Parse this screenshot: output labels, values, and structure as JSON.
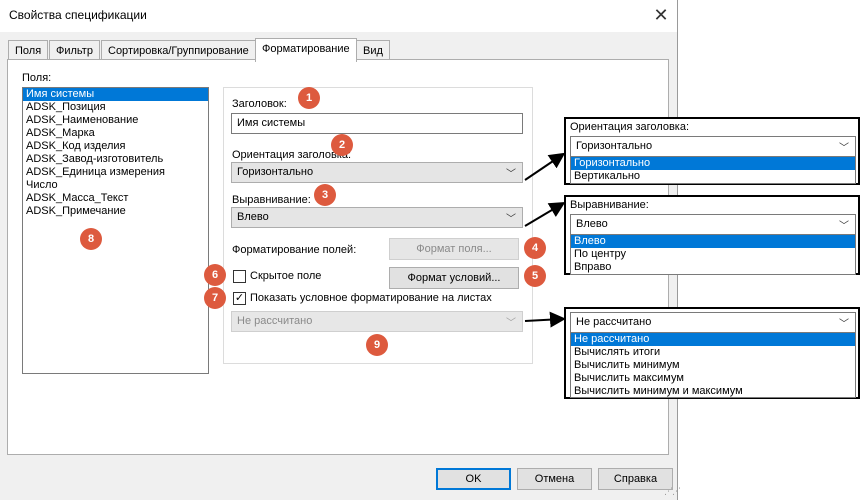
{
  "window": {
    "title": "Свойства спецификации",
    "close_glyph": "✕"
  },
  "tabs": [
    {
      "label": "Поля"
    },
    {
      "label": "Фильтр"
    },
    {
      "label": "Сортировка/Группирование"
    },
    {
      "label": "Форматирование"
    },
    {
      "label": "Вид"
    }
  ],
  "fields": {
    "label": "Поля:",
    "items": [
      "Имя системы",
      "ADSK_Позиция",
      "ADSK_Наименование",
      "ADSK_Марка",
      "ADSK_Код изделия",
      "ADSK_Завод-изготовитель",
      "ADSK_Единица измерения",
      "Число",
      "ADSK_Масса_Текст",
      "ADSK_Примечание"
    ]
  },
  "formatting": {
    "heading_label": "Заголовок:",
    "heading_value": "Имя системы",
    "orientation_label": "Ориентация заголовка:",
    "orientation_value": "Горизонтально",
    "alignment_label": "Выравнивание:",
    "alignment_value": "Влево",
    "field_format_label": "Форматирование полей:",
    "field_format_button": "Формат поля...",
    "hidden_field_label": "Скрытое поле",
    "hidden_field_checked": false,
    "condition_format_button": "Формат условий...",
    "show_conditional_label": "Показать условное форматирование на листах",
    "show_conditional_checked": true,
    "calc_value": "Не рассчитано"
  },
  "buttons": {
    "ok": "OK",
    "cancel": "Отмена",
    "help": "Справка"
  },
  "badges": [
    "1",
    "2",
    "3",
    "4",
    "5",
    "6",
    "7",
    "8",
    "9"
  ],
  "callouts": {
    "orientation": {
      "label": "Ориентация заголовка:",
      "value": "Горизонтально",
      "options": [
        "Горизонтально",
        "Вертикально"
      ],
      "selected": "Горизонтально"
    },
    "alignment": {
      "label": "Выравнивание:",
      "value": "Влево",
      "options": [
        "Влево",
        "По центру",
        "Вправо"
      ],
      "selected": "Влево"
    },
    "calc": {
      "value": "Не рассчитано",
      "options": [
        "Не рассчитано",
        "Вычислять итоги",
        "Вычислить минимум",
        "Вычислить максимум",
        "Вычислить минимум и максимум"
      ],
      "selected": "Не рассчитано"
    }
  },
  "colors": {
    "accent": "#0078d7",
    "badge": "#dd5a3e",
    "dialog_bg": "#f0f0f0"
  },
  "icons": {
    "chevron": "chevron-down-icon",
    "check": "checkmark-icon",
    "close": "close-icon"
  }
}
